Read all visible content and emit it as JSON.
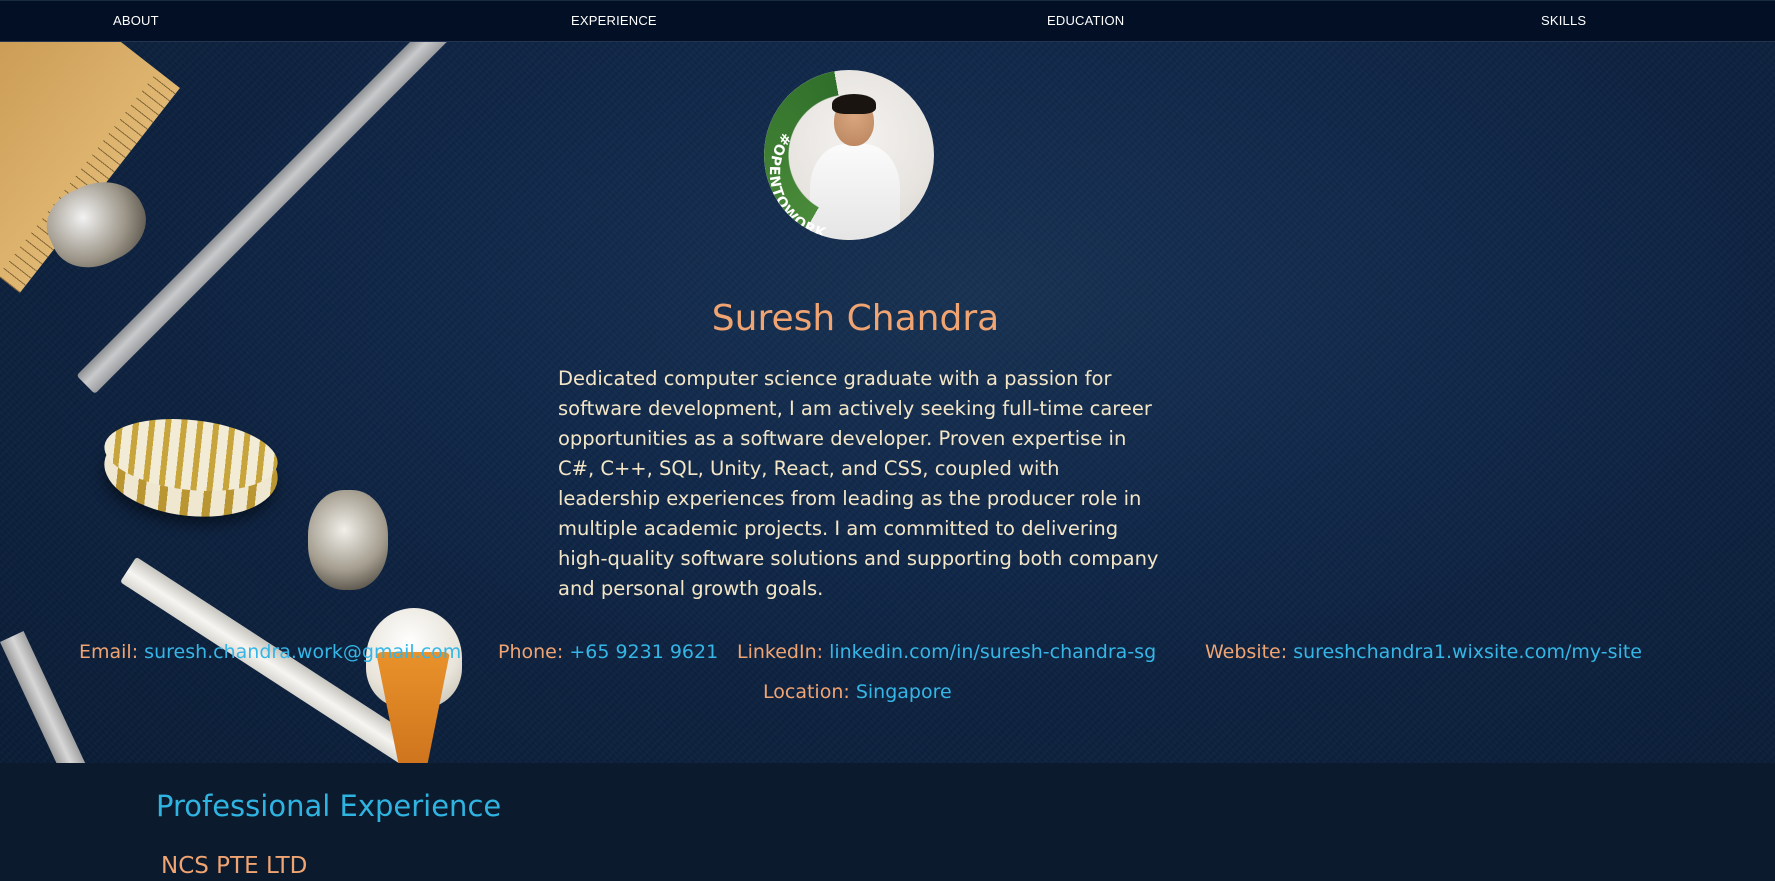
{
  "nav": {
    "about": "ABOUT",
    "experience": "EXPERIENCE",
    "education": "EDUCATION",
    "skills": "SKILLS"
  },
  "profile": {
    "badge_text": "#OPENTOWORK",
    "name": "Suresh Chandra",
    "bio": "Dedicated computer science graduate with a passion for software development, I am actively seeking full-time career opportunities as a software developer. Proven expertise in C#, C++, SQL, Unity, React, and CSS, coupled with leadership experiences from leading as the producer role in multiple academic projects. I am committed to delivering high-quality software solutions and supporting both company and personal growth goals."
  },
  "contact": {
    "email_label": "Email:",
    "email": "suresh.chandra.work@gmail.com",
    "phone_label": "Phone:",
    "phone": "+65 9231 9621",
    "linkedin_label": "LinkedIn:",
    "linkedin": "linkedin.com/in/suresh-chandra-sg",
    "website_label": "Website:",
    "website": "sureshchandra1.wixsite.com/my-site",
    "location_label": "Location:",
    "location": "Singapore"
  },
  "experience": {
    "title": "Professional Experience",
    "company": "NCS PTE LTD"
  },
  "colors": {
    "nav_bg": "#020f24",
    "accent_orange": "#f0a472",
    "link_blue": "#35b6e6",
    "section_title_blue": "#2fb3e1",
    "page_bg": "#0b1a2c",
    "badge_green": "#3a7d32"
  },
  "icons": {
    "avatar": "profile-photo",
    "badge": "open-to-work-ring"
  }
}
